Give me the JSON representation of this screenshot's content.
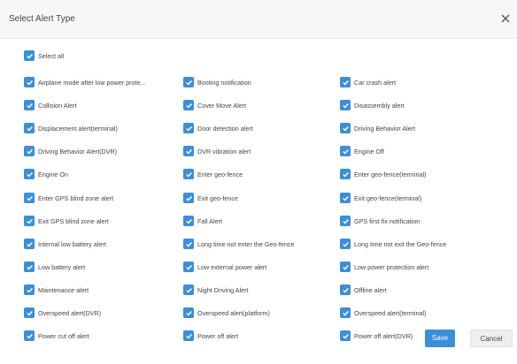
{
  "dialog": {
    "title": "Select Alert Type",
    "close_label": "×"
  },
  "select_all": {
    "label": "Select all",
    "checked": true
  },
  "columns": [
    [
      "Airplane mode after low power prote...",
      "Collision Alert",
      "Displacement alert(terminal)",
      "Driving Behavior Alert(DVR)",
      "Engine On",
      "Enter GPS blind zone alert",
      "Exit GPS blind zone alert",
      "Internal low battery alert",
      "Low battery alert",
      "Maintenance alert",
      "Overspeed alert(DVR)",
      "Power cut off alert"
    ],
    [
      "Booting notification",
      "Cover Move Alert",
      "Door detection alert",
      "DVR vibration alert",
      "Enter geo-fence",
      "Exit geo-fence",
      "Fall Alert",
      "Long time not enter the Geo-fence",
      "Low external power alert",
      "Night Driving Alert",
      "Overspeed alert(platform)",
      "Power off alert"
    ],
    [
      "Car crash alert",
      "Disassembly alert",
      "Driving Behavior Alert",
      "Engine Off",
      "Enter geo-fence(terminal)",
      "Exit geo-fence(terminal)",
      "GPS first fix notification",
      "Long time not exit the Geo-fence",
      "Low power protection alert",
      "Offline alert",
      "Overspeed alert(terminal)",
      "Power off alert(DVR)"
    ]
  ],
  "footer": {
    "save_label": "Save",
    "cancel_label": "Cancel"
  },
  "colors": {
    "accent": "#3a8fd8",
    "header_bg": "#f7f7f7"
  },
  "icons": {
    "checkbox": "checkbox-checked-icon",
    "close": "close-icon"
  }
}
